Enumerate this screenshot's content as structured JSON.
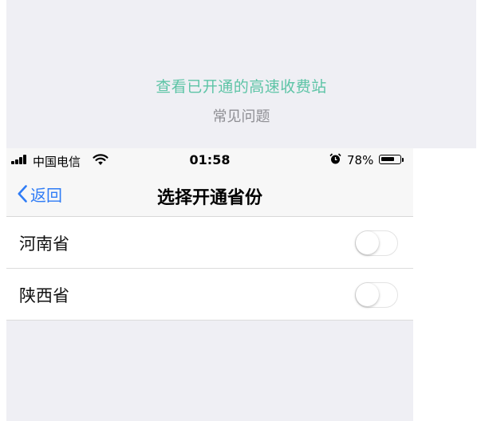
{
  "top": {
    "open_link": "查看已开通的高速收费站",
    "faq": "常见问题"
  },
  "status_bar": {
    "carrier": "中国电信",
    "time": "01:58",
    "battery_percent": "78%",
    "battery_level": 0.78
  },
  "nav": {
    "back_label": "返回",
    "title": "选择开通省份"
  },
  "provinces": [
    {
      "label": "河南省",
      "enabled": false
    },
    {
      "label": "陕西省",
      "enabled": false
    }
  ],
  "colors": {
    "link": "#5dc4a6",
    "ios_blue": "#2f7cf6"
  }
}
